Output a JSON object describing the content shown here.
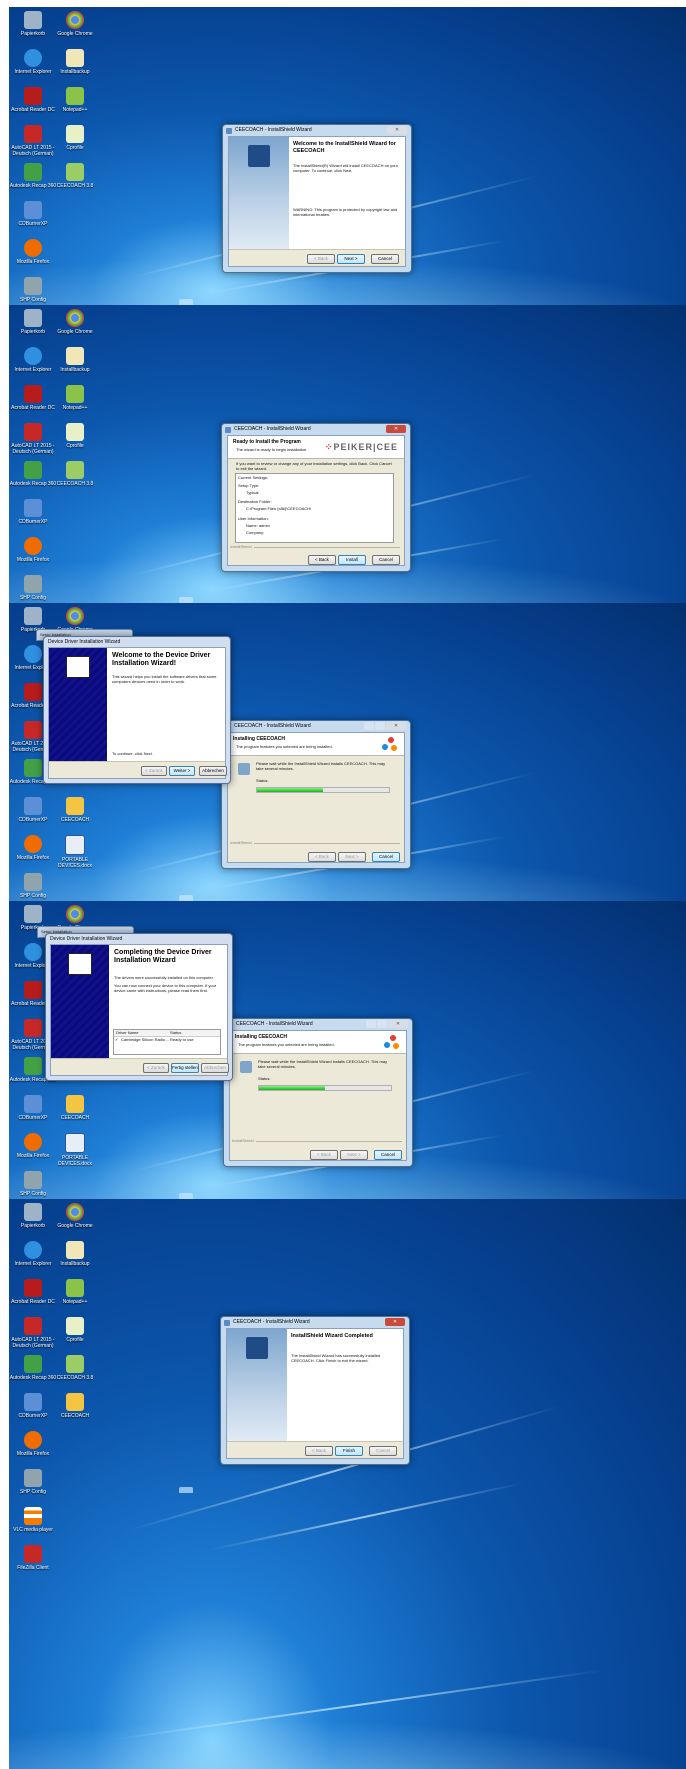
{
  "desktop": {
    "icons": [
      {
        "label": "Papierkorb"
      },
      {
        "label": "Google Chrome"
      },
      {
        "label": "Internet Explorer"
      },
      {
        "label": "Installbackup"
      },
      {
        "label": "Acrobat Reader DC"
      },
      {
        "label": "Notepad++"
      },
      {
        "label": "AutoCAD LT 2015 - Deutsch (German)"
      },
      {
        "label": "Cprofile"
      },
      {
        "label": "Autodesk Recap 360"
      },
      {
        "label": "CEECOACH 3.8"
      },
      {
        "label": "CDBurnerXP"
      },
      {
        "label": "CEECOACH"
      },
      {
        "label": "Mozilla Firefox"
      },
      {
        "label": "PORTABLE DEVICES.docx"
      },
      {
        "label": "SHP Config"
      },
      {
        "label": "VLC media player"
      },
      {
        "label": "FileZilla Client"
      }
    ]
  },
  "step1": {
    "window_title": "CEECOACH - InstallShield Wizard",
    "heading": "Welcome to the InstallShield Wizard for CEECOACH",
    "body": "The InstallShield(R) Wizard will install CEECOACH on your computer. To continue, click Next.",
    "warning": "WARNING: This program is protected by copyright law and international treaties.",
    "back": "< Back",
    "next": "Next >",
    "cancel": "Cancel"
  },
  "step2": {
    "window_title": "CEECOACH - InstallShield Wizard",
    "heading": "Ready to Install the Program",
    "subheading": "The wizard is ready to begin installation.",
    "brand": "PEIKER|CEE",
    "body": "If you want to review or change any of your installation settings, click Back. Click Cancel to exit the wizard.",
    "current_settings": "Current Settings:",
    "setup_type_label": "Setup Type:",
    "setup_type_value": "Typical",
    "dest_label": "Destination Folder:",
    "dest_value": "C:\\Program Files (x86)\\CEECOACH\\",
    "user_label": "User Information:",
    "user_name": "Name: admin",
    "user_company": "Company:",
    "installshield": "InstallShield",
    "back": "< Back",
    "install": "Install",
    "cancel": "Cancel"
  },
  "step3": {
    "behind_title": "Setup Installation",
    "dd_title": "Device Driver Installation Wizard",
    "dd_heading": "Welcome to the Device Driver Installation Wizard!",
    "dd_body": "This wizard helps you install the software drivers that some computers devices need in order to work.",
    "dd_continue": "To continue, click Next.",
    "dd_back": "< Zurück",
    "dd_next": "Weiter >",
    "dd_cancel": "Abbrechen",
    "is_title": "CEECOACH - InstallShield Wizard",
    "is_heading": "Installing CEECOACH",
    "is_sub": "The program features you selected are being installed.",
    "is_body": "Please wait while the InstallShield Wizard installs CEECOACH. This may take several minutes.",
    "status": "Status:",
    "progress": 0.5,
    "installshield": "InstallShield",
    "back": "< Back",
    "next": "Next >",
    "cancel": "Cancel"
  },
  "step4": {
    "behind_title": "Setup Installation",
    "dd_title": "Device Driver Installation Wizard",
    "dd_heading": "Completing the Device Driver Installation Wizard",
    "dd_body1": "The drivers were successfully installed on this computer.",
    "dd_body2": "You can now connect your device to this computer. If your device came with instructions, please read them first.",
    "col_driver": "Driver Name",
    "col_status": "Status",
    "row_driver": "Cambridge Silicon Radio ...",
    "row_status": "Ready to use",
    "dd_back": "< Zurück",
    "dd_finish": "Fertig stellen",
    "dd_cancel": "Abbrechen",
    "is_title": "CEECOACH - InstallShield Wizard",
    "is_heading": "Installing CEECOACH",
    "is_sub": "The program features you selected are being installed.",
    "is_body": "Please wait while the InstallShield Wizard installs CEECOACH. This may take several minutes.",
    "status": "Status:",
    "progress": 0.5,
    "installshield": "InstallShield",
    "back": "< Back",
    "next": "Next >",
    "cancel": "Cancel"
  },
  "step5": {
    "window_title": "CEECOACH - InstallShield Wizard",
    "heading": "InstallShield Wizard Completed",
    "body": "The InstallShield Wizard has successfully installed CEECOACH. Click Finish to exit the wizard.",
    "back": "< Back",
    "finish": "Finish",
    "cancel": "Cancel"
  },
  "colors": {
    "accent": "#0c57ad",
    "progress": "#19b319",
    "close": "#c84a3a"
  }
}
